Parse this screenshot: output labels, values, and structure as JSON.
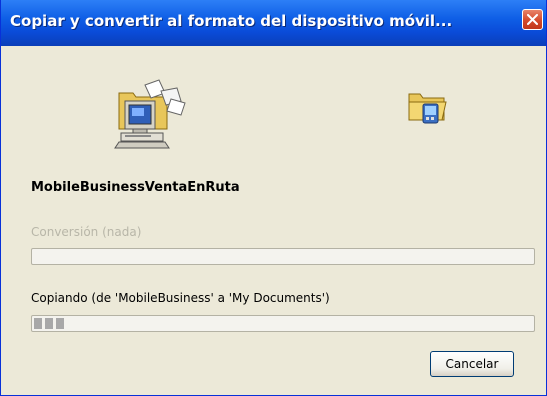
{
  "window": {
    "title": "Copiar y convertir al formato del dispositivo móvil..."
  },
  "icons": {
    "source": "desktop-computer-icon",
    "destination": "mobile-device-folder-icon"
  },
  "file_name": "MobileBusinessVentaEnRuta",
  "conversion": {
    "label": "Conversión (nada)",
    "progress": 0
  },
  "copy": {
    "label": "Copiando (de 'MobileBusiness' a 'My Documents')",
    "progress": 0.06
  },
  "buttons": {
    "cancel": "Cancelar"
  },
  "colors": {
    "titlebar": "#0a4bd8",
    "close_button": "#d4492a",
    "dialog_background": "#ece9d8"
  }
}
